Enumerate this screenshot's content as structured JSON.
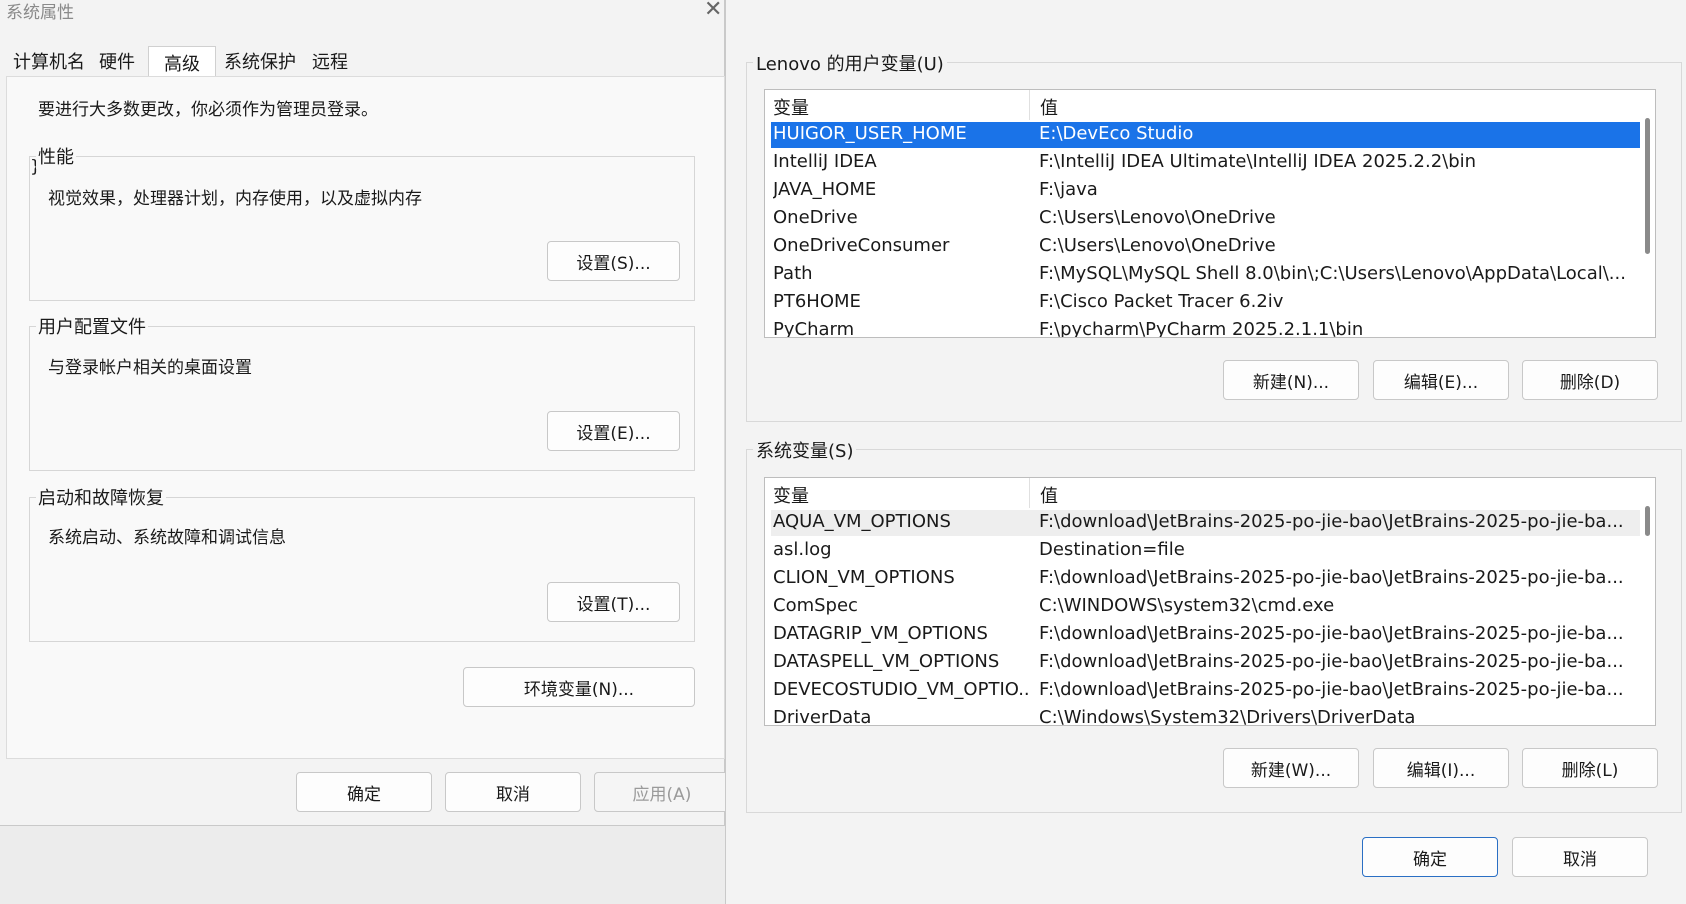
{
  "system_properties": {
    "title": "系统属性",
    "tabs": [
      {
        "label": "计算机名"
      },
      {
        "label": "硬件"
      },
      {
        "label": "高级"
      },
      {
        "label": "系统保护"
      },
      {
        "label": "远程"
      }
    ],
    "admin_notice": "要进行大多数更改，你必须作为管理员登录。",
    "performance": {
      "title": "性能",
      "desc": "视觉效果，处理器计划，内存使用，以及虚拟内存",
      "button": "设置(S)..."
    },
    "user_profiles": {
      "title": "用户配置文件",
      "desc": "与登录帐户相关的桌面设置",
      "button": "设置(E)..."
    },
    "startup_recovery": {
      "title": "启动和故障恢复",
      "desc": "系统启动、系统故障和调试信息",
      "button": "设置(T)..."
    },
    "env_button": "环境变量(N)...",
    "ok": "确定",
    "cancel": "取消",
    "apply": "应用(A)"
  },
  "env_vars": {
    "user_section": {
      "title": "Lenovo 的用户变量(U)",
      "col_var": "变量",
      "col_val": "值",
      "rows": [
        {
          "name": "HUIGOR_USER_HOME",
          "value": "E:\\DevEco Studio"
        },
        {
          "name": "IntelliJ IDEA",
          "value": "F:\\IntelliJ IDEA Ultimate\\IntelliJ IDEA 2025.2.2\\bin"
        },
        {
          "name": "JAVA_HOME",
          "value": "F:\\java"
        },
        {
          "name": "OneDrive",
          "value": "C:\\Users\\Lenovo\\OneDrive"
        },
        {
          "name": "OneDriveConsumer",
          "value": "C:\\Users\\Lenovo\\OneDrive"
        },
        {
          "name": "Path",
          "value": "F:\\MySQL\\MySQL Shell 8.0\\bin\\;C:\\Users\\Lenovo\\AppData\\Local\\..."
        },
        {
          "name": "PT6HOME",
          "value": "F:\\Cisco Packet Tracer 6.2iv"
        },
        {
          "name": "PyCharm",
          "value": "F:\\pycharm\\PyCharm 2025.2.1.1\\bin"
        }
      ],
      "new": "新建(N)...",
      "edit": "编辑(E)...",
      "delete": "删除(D)"
    },
    "system_section": {
      "title": "系统变量(S)",
      "col_var": "变量",
      "col_val": "值",
      "rows": [
        {
          "name": "AQUA_VM_OPTIONS",
          "value": "F:\\download\\JetBrains-2025-po-jie-bao\\JetBrains-2025-po-jie-ba..."
        },
        {
          "name": "asl.log",
          "value": "Destination=file"
        },
        {
          "name": "CLION_VM_OPTIONS",
          "value": "F:\\download\\JetBrains-2025-po-jie-bao\\JetBrains-2025-po-jie-ba..."
        },
        {
          "name": "ComSpec",
          "value": "C:\\WINDOWS\\system32\\cmd.exe"
        },
        {
          "name": "DATAGRIP_VM_OPTIONS",
          "value": "F:\\download\\JetBrains-2025-po-jie-bao\\JetBrains-2025-po-jie-ba..."
        },
        {
          "name": "DATASPELL_VM_OPTIONS",
          "value": "F:\\download\\JetBrains-2025-po-jie-bao\\JetBrains-2025-po-jie-ba..."
        },
        {
          "name": "DEVECOSTUDIO_VM_OPTIO...",
          "value": "F:\\download\\JetBrains-2025-po-jie-bao\\JetBrains-2025-po-jie-ba..."
        },
        {
          "name": "DriverData",
          "value": "C:\\Windows\\System32\\Drivers\\DriverData"
        }
      ],
      "new": "新建(W)...",
      "edit": "编辑(I)...",
      "delete": "删除(L)"
    },
    "ok": "确定",
    "cancel": "取消"
  },
  "colors": {
    "selection": "#1a73e8",
    "primary_border": "#2a6fc4"
  }
}
